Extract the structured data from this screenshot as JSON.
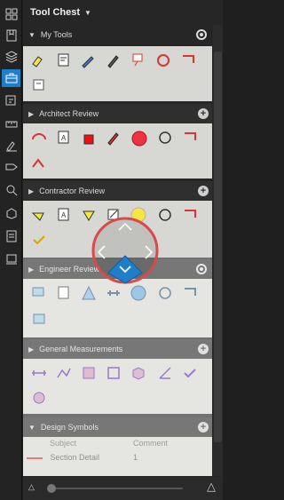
{
  "panel": {
    "title": "Tool Chest",
    "my_tools_label": "My Tools"
  },
  "sections": {
    "architect": "Architect Review",
    "contractor": "Contractor Review",
    "engineer": "Engineer Review",
    "measurements": "General Measurements",
    "symbols": "Design Symbols"
  },
  "symbols_table": {
    "col_subject": "Subject",
    "col_comment": "Comment",
    "row_subject": "Section Detail",
    "row_comment": "1"
  },
  "rail_icons": [
    "thumbnails-icon",
    "bookmarks-icon",
    "layers-icon",
    "toolchest-icon",
    "markups-icon",
    "measure-icon",
    "signature-icon",
    "tag-icon",
    "search-icon",
    "properties-icon",
    "forms-icon",
    "stamp-icon"
  ],
  "colors": {
    "accent": "#1f7ec9",
    "highlight_ring": "#d94a4a",
    "tool_bg": "#d7d7d3"
  }
}
